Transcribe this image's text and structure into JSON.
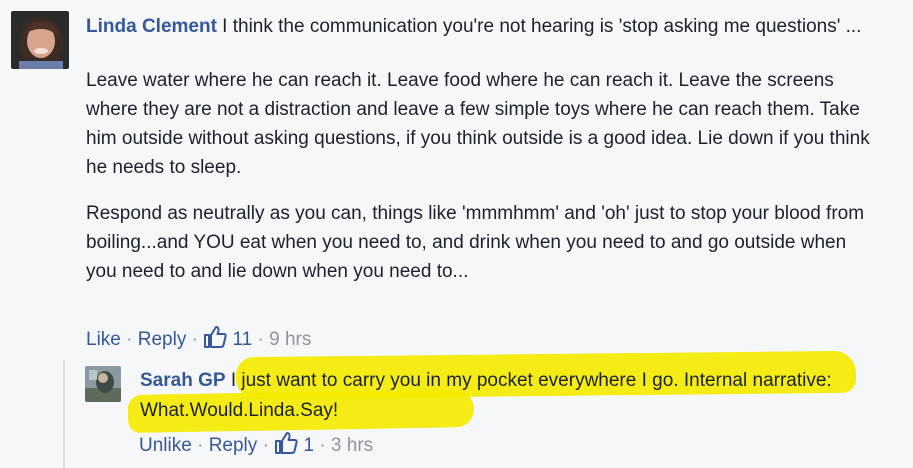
{
  "comment1": {
    "author": "Linda Clement",
    "intro": " I think the communication you're not hearing is 'stop asking me questions' ...",
    "para2": "Leave water where he can reach it. Leave food where he can reach it. Leave the screens where they are not a distraction and leave a few simple toys where he can reach them. Take him outside without asking questions, if you think outside is a good idea. Lie down if you think he needs to sleep.",
    "para3": "Respond as neutrally as you can, things like 'mmmhmm' and 'oh' just to stop your blood from boiling...and YOU eat when you need to, and drink when you need to and go outside when you need to and lie down when you need to...",
    "actions": {
      "like": "Like",
      "reply": "Reply",
      "like_count": "11",
      "time": "9 hrs"
    }
  },
  "reply1": {
    "author": "Sarah GP",
    "text": " I just want to carry you in my pocket everywhere I go. Internal narrative: What.Would.Linda.Say!",
    "actions": {
      "unlike": "Unlike",
      "reply": "Reply",
      "like_count": "1",
      "time": "3 hrs"
    }
  },
  "separator": "·",
  "icons": {
    "like": "thumbs-up-icon"
  },
  "colors": {
    "name": "#365899",
    "meta": "#90949c",
    "highlight": "#f3ea00",
    "background": "#f6f7f9"
  }
}
